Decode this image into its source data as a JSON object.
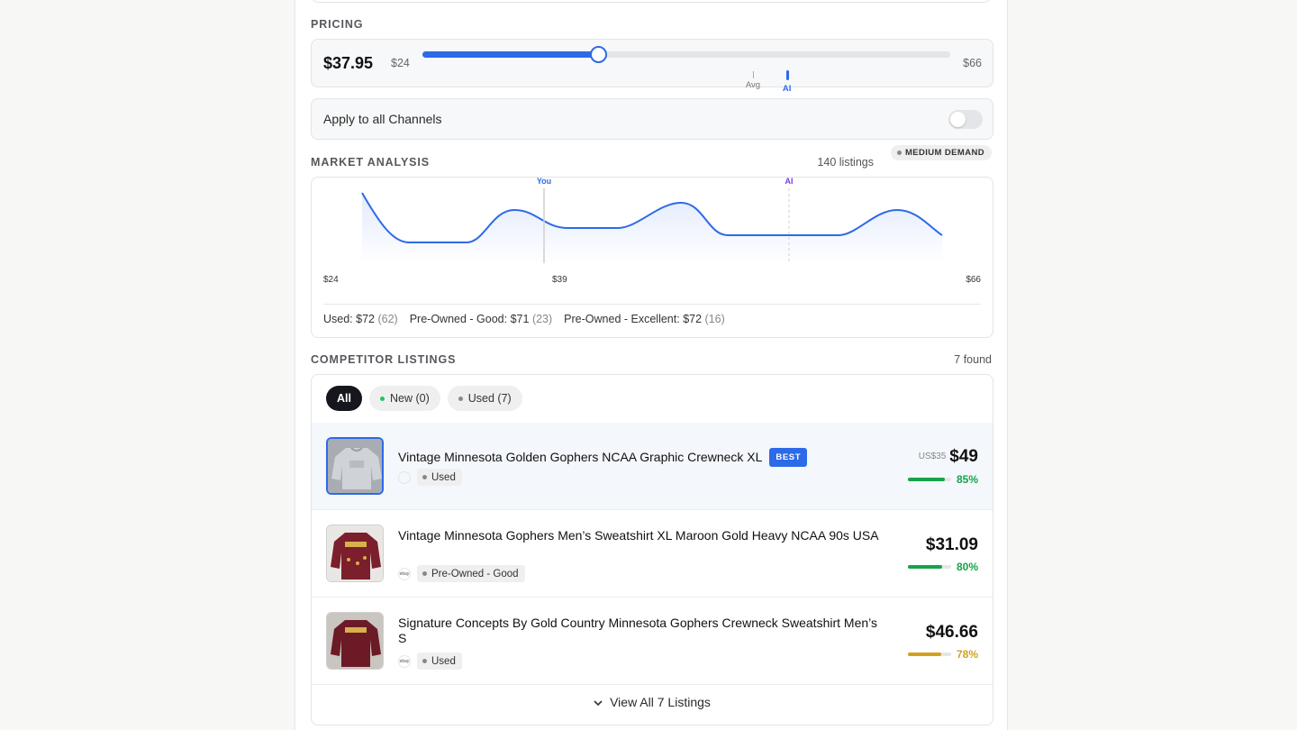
{
  "pricing": {
    "label": "PRICING",
    "current_price": "$37.95",
    "min_label": "$24",
    "max_label": "$66",
    "min_value": 24,
    "max_value": 66,
    "current_value": 37.95,
    "avg_value": 50.3,
    "ai_value": 53.0,
    "avg_marker_label": "Avg",
    "ai_marker_label": "AI",
    "accent_color": "#2d6ae8"
  },
  "apply_channels": {
    "label": "Apply to all Channels",
    "enabled": false
  },
  "market": {
    "label": "MARKET ANALYSIS",
    "listings_count": "140 listings",
    "demand_badge": "MEDIUM DEMAND",
    "chart_you_label": "You",
    "chart_ai_label": "AI",
    "chart_x_min": "$24",
    "chart_x_mid": "$39",
    "chart_x_max": "$66",
    "conditions": [
      {
        "name": "Used:",
        "price": "$72",
        "count": "(62)"
      },
      {
        "name": "Pre-Owned - Good:",
        "price": "$71",
        "count": "(23)"
      },
      {
        "name": "Pre-Owned - Excellent:",
        "price": "$72",
        "count": "(16)"
      }
    ]
  },
  "chart_data": {
    "type": "area",
    "x_min": 24,
    "x_max": 66,
    "x_ticks": [
      "$24",
      "$39",
      "$66"
    ],
    "markers": [
      {
        "label": "You",
        "x": 39
      },
      {
        "label": "AI",
        "x": 55
      }
    ],
    "density_shape": "multimodal distribution of competitor prices",
    "line_color": "#2d6ae8"
  },
  "competitors": {
    "label": "COMPETITOR LISTINGS",
    "found_count": "7 found",
    "filters": [
      {
        "label": "All",
        "active": true,
        "dot": ""
      },
      {
        "label": "New (0)",
        "active": false,
        "dot": "#22c55e"
      },
      {
        "label": "Used (7)",
        "active": false,
        "dot": "#888888"
      }
    ],
    "listings": [
      {
        "title": "Vintage Minnesota Golden Gophers NCAA Graphic Crewneck XL",
        "badge": "BEST",
        "condition": "Used",
        "old_price": "US$35",
        "price": "$49",
        "match": "85%",
        "match_value": 0.85,
        "match_color": "#16a34a",
        "source": "",
        "image": "grey-crewneck"
      },
      {
        "title": "Vintage Minnesota Gophers Men’s Sweatshirt XL Maroon Gold Heavy NCAA 90s USA",
        "badge": "",
        "condition": "Pre-Owned - Good",
        "old_price": "",
        "price": "$31.09",
        "match": "80%",
        "match_value": 0.8,
        "match_color": "#16a34a",
        "source": "ebay",
        "image": "maroon-sweatshirt"
      },
      {
        "title": "Signature Concepts By Gold Country Minnesota Gophers Crewneck Sweatshirt Men’s S",
        "badge": "",
        "condition": "Used",
        "old_price": "",
        "price": "$46.66",
        "match": "78%",
        "match_value": 0.78,
        "match_color": "#d4a020",
        "source": "ebay",
        "image": "maroon-crewneck"
      }
    ],
    "view_all": "View All 7 Listings"
  }
}
